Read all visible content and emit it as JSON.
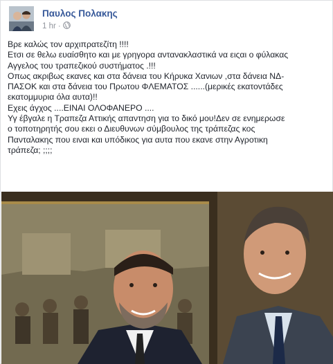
{
  "post": {
    "author": "Παυλος Πολακης",
    "time": "1 hr",
    "separator": "·",
    "privacy_icon": "globe-icon",
    "lines": [
      "Βρε καλώς τον αρχιπρατεζίτη !!!!",
      "Ετσι σε θελω ευαίσθητο και με γρηγορα αντανακλαστικά να ειςαι ο φύλακας",
      "Αγγελος του τραπεζικού συστήματος .!!!",
      "Οπως ακριβως εκανες και στα δάνεια του Κήρυκα Χανιων ,στα δάνεια ΝΔ-",
      "ΠΑΣΟΚ και στα δάνεια του Πρωτου ΦΛΕΜΑΤΟΣ ......(μερικές εκατοντάδες",
      "εκατομμυρια όλα αυτα)!!",
      "Εχεις άγχος ....ΕΙΝΑΙ ΟΛΟΦΑΝΕΡΟ ....",
      "Υγ έβγαλε η Τραπεζα Αττικής απαντηση για το δικό μου!Δεν σε ενημερωσε",
      "ο τοποτηρητής σου εκει ο Διευθυνων σύμβουλος της τράπεζας κος",
      "Πανταλακης που ειναι και υπόδικος για αυτα που εκανε στην Αγροτικη",
      "τράπεζα; ;;;;"
    ]
  }
}
